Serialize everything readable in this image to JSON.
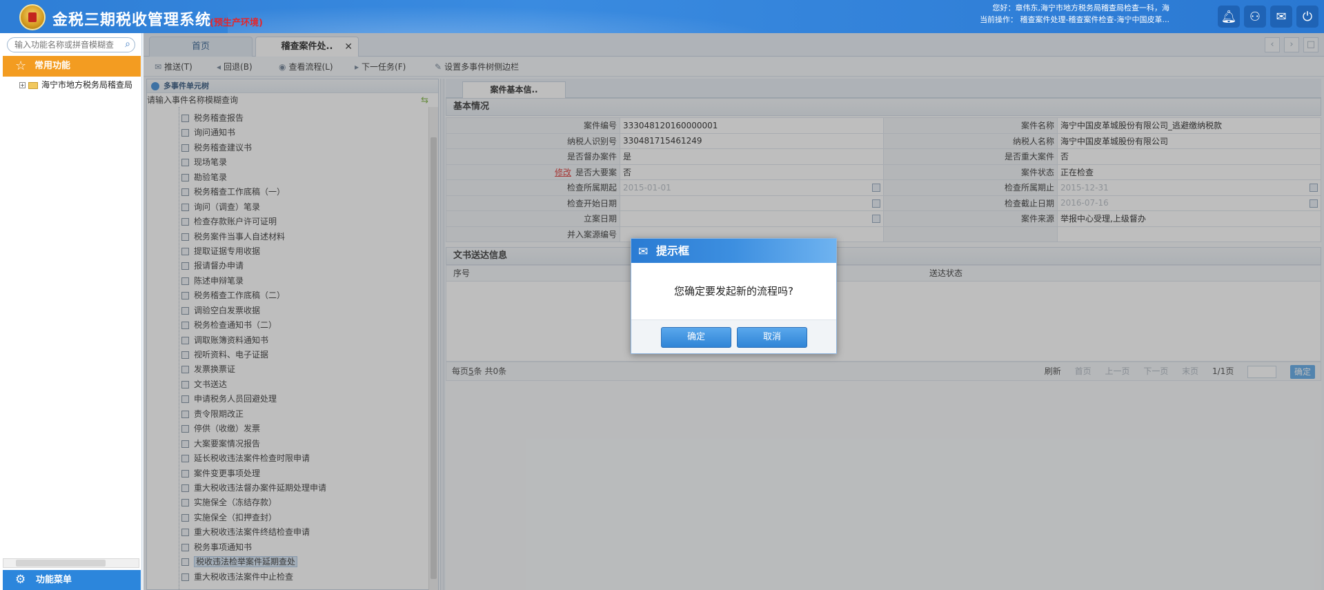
{
  "header": {
    "title": "金税三期税收管理系统",
    "env": "(预生产环境)",
    "user_line1": "您好：章伟东,海宁市地方税务局稽查局检查一科，海",
    "user_line2": "当前操作： 稽查案件处理-稽查案件检查-海宁中国皮革..."
  },
  "sidebar": {
    "search_placeholder": "输入功能名称或拼音模糊查",
    "fav_label": "常用功能",
    "tree_item": "海宁市地方税务局稽查局",
    "menu_label": "功能菜单"
  },
  "tabs": [
    {
      "label": "首页"
    },
    {
      "label": "稽查案件处..",
      "close": "✕"
    }
  ],
  "toolbar": [
    {
      "label": "推送(T)"
    },
    {
      "label": "回退(B)"
    },
    {
      "label": "查看流程(L)"
    },
    {
      "label": "下一任务(F)"
    },
    {
      "label": "设置多事件树侧边栏"
    }
  ],
  "events_panel": {
    "title": "多事件单元树",
    "search_placeholder": "请输入事件名称模糊查询",
    "items": [
      "税务稽查报告",
      "询问通知书",
      "税务稽查建议书",
      "现场笔录",
      "勘验笔录",
      "税务稽查工作底稿（一）",
      "询问（调查）笔录",
      "检查存款账户许可证明",
      "税务案件当事人自述材料",
      "提取证据专用收据",
      "报请督办申请",
      "陈述申辩笔录",
      "税务稽查工作底稿（二）",
      "调验空白发票收据",
      "税务检查通知书（二）",
      "调取账簿资料通知书",
      "视听资料、电子证据",
      "发票换票证",
      "文书送达",
      "申请税务人员回避处理",
      "责令限期改正",
      "停供（收缴）发票",
      "大案要案情况报告",
      "延长税收违法案件检查时限申请",
      "案件变更事项处理",
      "重大税收违法督办案件延期处理申请",
      "实施保全（冻结存款）",
      "实施保全（扣押查封）",
      "重大税收违法案件终结检查申请",
      "税务事项通知书",
      "税收违法检举案件延期查处",
      "重大税收违法案件中止检查"
    ],
    "selected_index": 30
  },
  "detail": {
    "tab_label": "案件基本信..",
    "basic_section": "基本情况",
    "rows": [
      {
        "l1": "案件编号",
        "v1": "333048120160000001",
        "l2": "案件名称",
        "v2": "海宁中国皮革城股份有限公司_逃避缴纳税款"
      },
      {
        "l1": "纳税人识别号",
        "v1": "330481715461249",
        "l2": "纳税人名称",
        "v2": "海宁中国皮革城股份有限公司"
      },
      {
        "l1": "是否督办案件",
        "v1": "是",
        "l2": "是否重大案件",
        "v2": "否"
      },
      {
        "l1": "是否大要案",
        "mod": "修改",
        "v1": "否",
        "l2": "案件状态",
        "v2": "正在检查"
      },
      {
        "l1": "检查所属期起",
        "v1": "2015-01-01",
        "l2": "检查所属期止",
        "v2": "2015-12-31"
      },
      {
        "l1": "检查开始日期",
        "v1": "",
        "l2": "检查截止日期",
        "v2": "2016-07-16"
      },
      {
        "l1": "立案日期",
        "v1": "",
        "l2": "案件来源",
        "v2": "举报中心受理,上级督办"
      },
      {
        "l1": "并入案源编号",
        "v1": "",
        "l2": "",
        "v2": ""
      }
    ],
    "docs_section": "文书送达信息",
    "grid_cols": [
      "序号",
      "送达状态"
    ],
    "pager": {
      "per_page_prefix": "每页",
      "per_page": "5",
      "per_page_suffix": "条 共0条",
      "refresh": "刷新",
      "first": "首页",
      "prev": "上一页",
      "next": "下一页",
      "last": "末页",
      "page_info": "1/1页",
      "go": "确定"
    }
  },
  "dialog": {
    "title": "提示框",
    "message": "您确定要发起新的流程吗?",
    "ok": "确定",
    "cancel": "取消"
  }
}
